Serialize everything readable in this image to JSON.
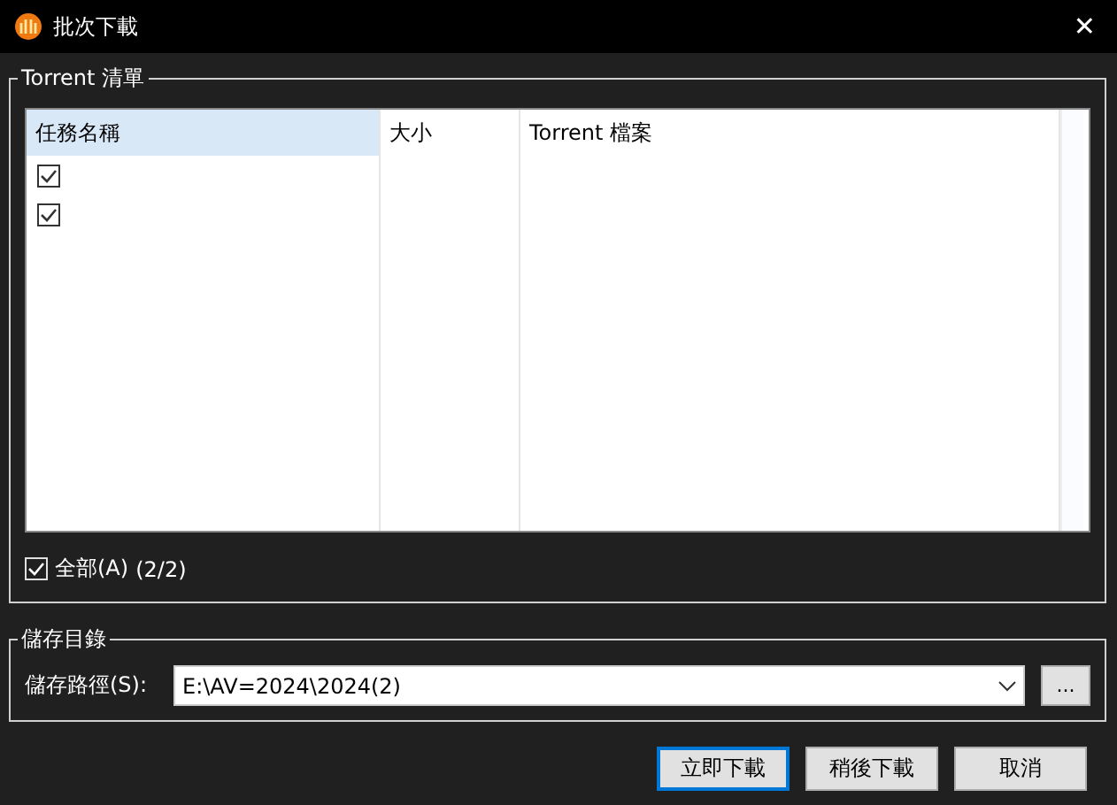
{
  "window": {
    "title": "批次下載",
    "close": "✕"
  },
  "torrent_group": {
    "title": "Torrent 清單",
    "columns": [
      "任務名稱",
      "大小",
      "Torrent 檔案"
    ],
    "rows": [
      {
        "checked": true
      },
      {
        "checked": true
      }
    ],
    "select_all": {
      "label": "全部(A)",
      "checked": true,
      "count": "(2/2)"
    }
  },
  "save_group": {
    "title": "儲存目錄",
    "path_label": "儲存路徑(S):",
    "path": "E:\\AV=2024\\2024(2)",
    "browse": "..."
  },
  "buttons": [
    {
      "label": "立即下載",
      "selected": true
    },
    {
      "label": "稍後下載",
      "selected": false
    },
    {
      "label": "取消",
      "selected": false
    }
  ]
}
